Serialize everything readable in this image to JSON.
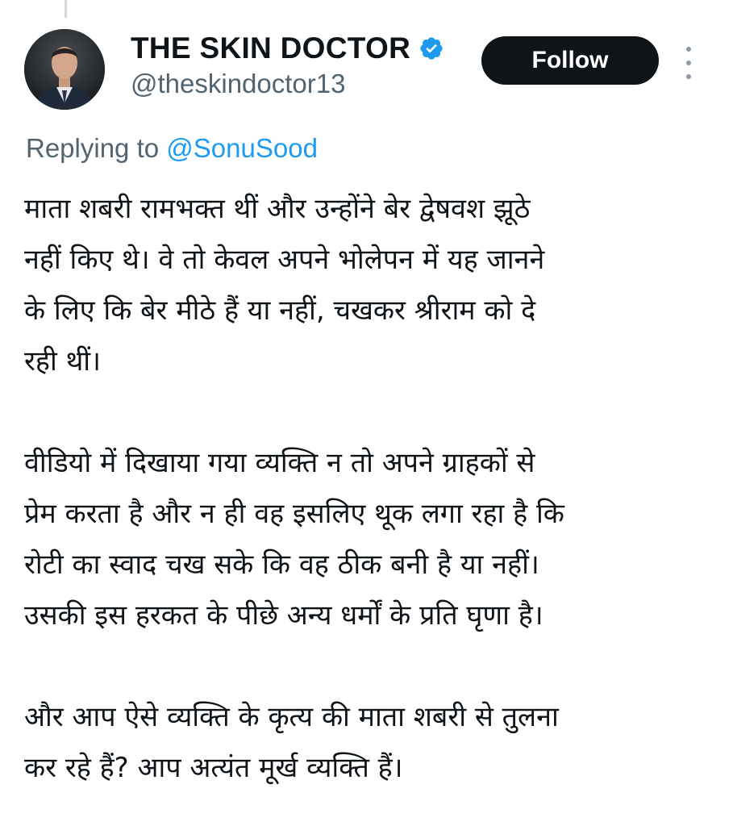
{
  "tweet": {
    "author": {
      "display_name": "THE SKIN DOCTOR",
      "handle": "@theskindoctor13",
      "verified": true,
      "avatar_icon": "profile-photo"
    },
    "follow_label": "Follow",
    "replying_prefix": "Replying to",
    "replying_to": "@SonuSood",
    "paragraphs": [
      "माता शबरी रामभक्त थीं और उन्होंने बेर द्वेषवश झूठे\nनहीं किए थे। वे तो केवल अपने भोलेपन में यह जानने\nके लिए कि बेर मीठे हैं या नहीं, चखकर श्रीराम को दे\nरही थीं।",
      "वीडियो में दिखाया गया व्यक्ति न तो अपने ग्राहकों से\nप्रेम करता है और न ही वह इसलिए थूक लगा रहा है कि\nरोटी का स्वाद चख सके कि वह ठीक बनी है या नहीं।\nउसकी इस हरकत के पीछे अन्य धर्मों के प्रति घृणा है।",
      "और आप ऐसे व्यक्ति के कृत्य की माता शबरी से तुलना\nकर रहे हैं? आप अत्यंत मूर्ख व्यक्ति हैं।"
    ]
  },
  "colors": {
    "verified_badge": "#1d9bf0",
    "mention": "#1d9bf0",
    "secondary_text": "#536471",
    "follow_bg": "#0f1419"
  }
}
